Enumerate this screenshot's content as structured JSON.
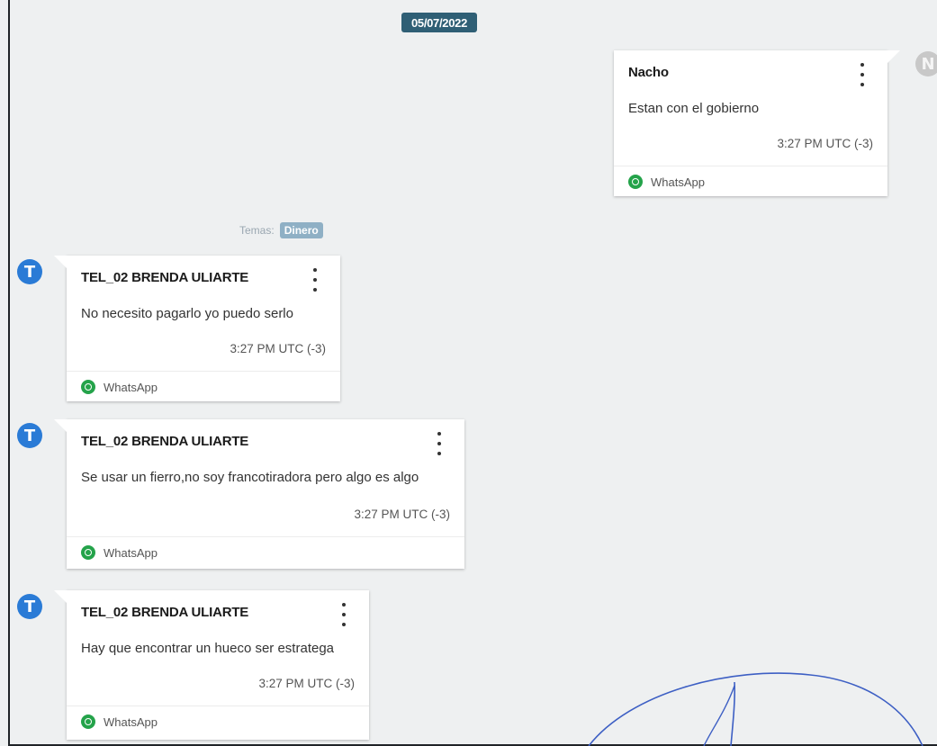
{
  "date": "05/07/2022",
  "topics": {
    "label": "Temas:",
    "tag": "Dinero"
  },
  "messages": [
    {
      "sender": "Nacho",
      "avatar_initial": "N",
      "side": "right",
      "text": "Estan con el gobierno",
      "time": "3:27 PM UTC (-3)",
      "source": "WhatsApp",
      "source_icon": "whatsapp-icon"
    },
    {
      "sender": "TEL_02 BRENDA ULIARTE",
      "avatar_initial": "T",
      "side": "left",
      "text": "No necesito pagarlo yo puedo serlo",
      "time": "3:27 PM UTC (-3)",
      "source": "WhatsApp",
      "source_icon": "whatsapp-icon"
    },
    {
      "sender": "TEL_02 BRENDA ULIARTE",
      "avatar_initial": "T",
      "side": "left",
      "text": "Se usar un fierro,no soy francotiradora pero algo es algo",
      "time": "3:27 PM UTC (-3)",
      "source": "WhatsApp",
      "source_icon": "whatsapp-icon"
    },
    {
      "sender": "TEL_02 BRENDA ULIARTE",
      "avatar_initial": "T",
      "side": "left",
      "text": "Hay que encontrar un hueco ser estratega",
      "time": "3:27 PM UTC (-3)",
      "source": "WhatsApp",
      "source_icon": "whatsapp-icon"
    }
  ],
  "colors": {
    "date_badge": "#2f5f75",
    "avatar_blue": "#2a7bd6",
    "whatsapp_green": "#24a34a",
    "signature_ink": "#3d5fc4"
  }
}
